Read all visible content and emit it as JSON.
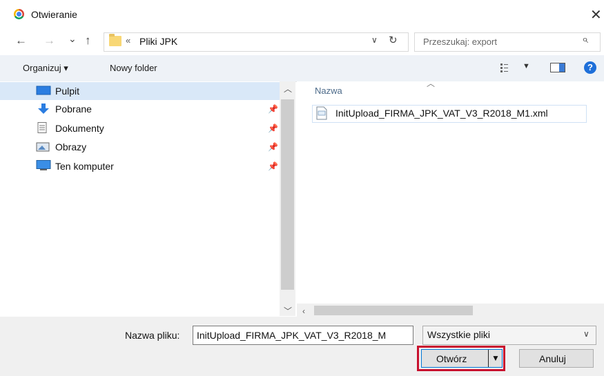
{
  "window": {
    "title": "Otwieranie"
  },
  "nav": {
    "back_icon": "←",
    "forward_icon": "→",
    "recent_icon": "⌄",
    "up_icon": "↑",
    "breadcrumb_sep": "«",
    "breadcrumb": "Pliki JPK",
    "address_chevron": "∨",
    "refresh_icon": "↻",
    "search_placeholder": "Przeszukaj: export"
  },
  "toolbar": {
    "organize_label": "Organizuj ▾",
    "new_folder_label": "Nowy folder",
    "help_label": "?"
  },
  "sidebar": {
    "items": [
      {
        "label": "Pulpit",
        "icon": "desktop-icon",
        "selected": true,
        "pinned": false
      },
      {
        "label": "Pobrane",
        "icon": "download-icon",
        "selected": false,
        "pinned": true
      },
      {
        "label": "Dokumenty",
        "icon": "documents-icon",
        "selected": false,
        "pinned": true
      },
      {
        "label": "Obrazy",
        "icon": "pictures-icon",
        "selected": false,
        "pinned": true
      },
      {
        "label": "Ten komputer",
        "icon": "computer-icon",
        "selected": false,
        "pinned": true
      }
    ]
  },
  "file_list": {
    "column_name": "Nazwa",
    "files": [
      {
        "name": "InitUpload_FIRMA_JPK_VAT_V3_R2018_M1.xml",
        "icon": "xml-file-icon"
      }
    ]
  },
  "footer": {
    "filename_label": "Nazwa pliku:",
    "filename_value": "InitUpload_FIRMA_JPK_VAT_V3_R2018_M",
    "filter_value": "Wszystkie pliki",
    "open_label": "Otwórz",
    "cancel_label": "Anuluj"
  },
  "colors": {
    "highlight_frame": "#c8102e",
    "selection": "#d9e8f8",
    "accent": "#0078d7"
  }
}
